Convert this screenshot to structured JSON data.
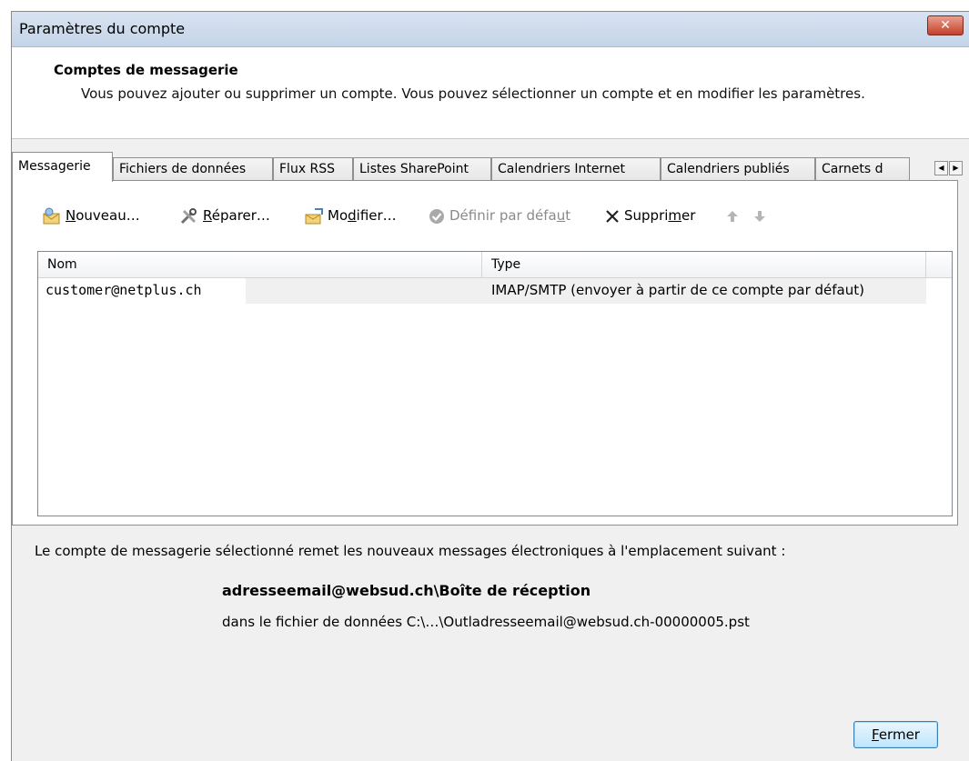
{
  "window": {
    "title": "Paramètres du compte",
    "close_glyph": "✕"
  },
  "header": {
    "title": "Comptes de messagerie",
    "subtitle": "Vous pouvez ajouter ou supprimer un compte. Vous pouvez sélectionner un compte et en modifier les paramètres."
  },
  "tabs": [
    {
      "label": "Messagerie",
      "active": true
    },
    {
      "label": "Fichiers de données"
    },
    {
      "label": "Flux RSS"
    },
    {
      "label": "Listes SharePoint"
    },
    {
      "label": "Calendriers Internet"
    },
    {
      "label": "Calendriers publiés"
    },
    {
      "label": "Carnets d"
    }
  ],
  "toolbar": {
    "new": {
      "pre": "",
      "key": "N",
      "post": "ouveau…"
    },
    "repair": {
      "pre": "",
      "key": "R",
      "post": "éparer…"
    },
    "change": {
      "pre": "Mo",
      "key": "d",
      "post": "ifier…"
    },
    "set_default": {
      "pre": "Définir par défa",
      "key": "u",
      "post": "t"
    },
    "remove": {
      "pre": "Suppri",
      "key": "m",
      "post": "er"
    }
  },
  "list": {
    "columns": [
      "Nom",
      "Type"
    ],
    "rows": [
      {
        "name": "customer@netplus.ch",
        "type": "IMAP/SMTP (envoyer à partir de ce compte par défaut)"
      }
    ]
  },
  "delivery": {
    "label": "Le compte de messagerie sélectionné remet les nouveaux messages électroniques à l'emplacement suivant :",
    "folder": "adresseemail@websud.ch\\Boîte de réception",
    "file": "dans le fichier de données C:\\…\\Outladresseemail@websud.ch-00000005.pst"
  },
  "footer": {
    "close": {
      "pre": "",
      "key": "F",
      "post": "ermer"
    }
  },
  "colors": {
    "accent": "#3c7fb1",
    "titlebar": "#c4d4e8",
    "close_red": "#c4402a"
  }
}
